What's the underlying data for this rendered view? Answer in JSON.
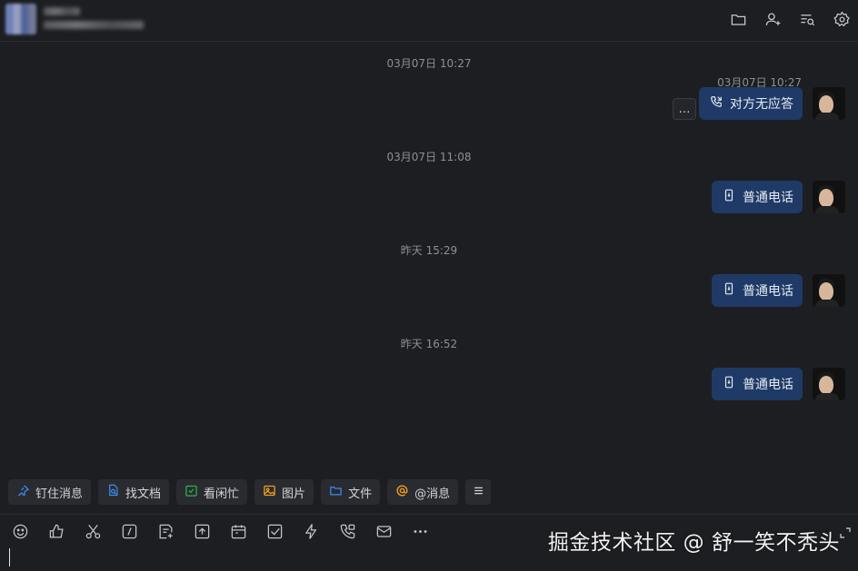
{
  "header": {
    "icons": [
      "folder-icon",
      "add-member-icon",
      "search-history-icon",
      "settings-icon"
    ]
  },
  "messages": [
    {
      "center_time": "03月07日 10:27",
      "msg_time": "03月07日 10:27",
      "label": "对方无应答",
      "icon": "phone-icon",
      "has_more": true,
      "more_label": "…"
    },
    {
      "center_time": "03月07日 11:08",
      "label": "普通电话",
      "icon": "mobile-phone-icon"
    },
    {
      "center_time": "昨天 15:29",
      "label": "普通电话",
      "icon": "mobile-phone-icon"
    },
    {
      "center_time": "昨天 16:52",
      "label": "普通电话",
      "icon": "mobile-phone-icon"
    }
  ],
  "chips": [
    {
      "label": "钉住消息",
      "icon": "pin-icon",
      "color": "#3b8cf0"
    },
    {
      "label": "找文档",
      "icon": "doc-search-icon",
      "color": "#3b8cf0"
    },
    {
      "label": "看闲忙",
      "icon": "calendar-check-icon",
      "color": "#27b34a"
    },
    {
      "label": "图片",
      "icon": "image-icon",
      "color": "#f0a020"
    },
    {
      "label": "文件",
      "icon": "folder-icon",
      "color": "#3b8cf0"
    },
    {
      "label": "@消息",
      "icon": "at-icon",
      "color": "#f0a020"
    }
  ],
  "toolbar": [
    "emoji-icon",
    "thumbs-up-icon",
    "scissors-icon",
    "slash-command-icon",
    "note-add-icon",
    "upload-icon",
    "calendar-icon",
    "task-check-icon",
    "lightning-icon",
    "call-icon",
    "mail-icon",
    "more-icon"
  ],
  "watermark": "掘金技术社区 @ 舒一笑不秃头"
}
